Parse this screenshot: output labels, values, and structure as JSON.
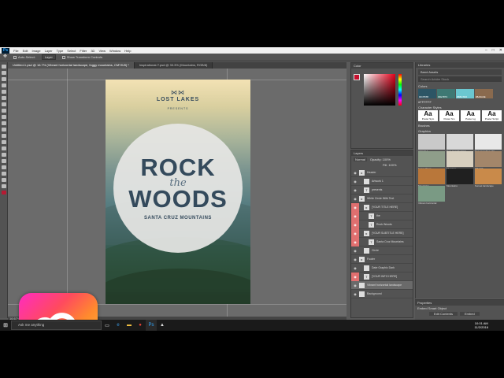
{
  "menu": {
    "app_icon": "Ps",
    "items": [
      "File",
      "Edit",
      "Image",
      "Layer",
      "Type",
      "Select",
      "Filter",
      "3D",
      "View",
      "Window",
      "Help"
    ]
  },
  "options": {
    "auto_select": "Auto-Select:",
    "layer_select": "Layer",
    "show_transform": "Show Transform Controls"
  },
  "tabs": [
    {
      "label": "Untitled-1.psd @ 16.7% (Vibrant horizontal landscape, foggy mountains, CMYK/8) *"
    },
    {
      "label": "Inspirational-T.psd @ 33.3% (Mountains, RGB/8)"
    }
  ],
  "poster": {
    "logo_mark": "⋈⋈",
    "brand": "LOST LAKES",
    "presents": "PRESENTS",
    "line1": "ROCK",
    "line2": "the",
    "line3": "WOODS",
    "subtitle": "SANTA CRUZ MOUNTAINS"
  },
  "status": {
    "zoom": "16.67%"
  },
  "color_panel": {
    "title": "Color",
    "fg_color": "#c8102e"
  },
  "layers_panel": {
    "title": "Layers",
    "mode": "Normal",
    "opacity": "Opacity: 100%",
    "fill": "Fill: 100%",
    "rows": [
      {
        "name": "Header",
        "icon": "folder-icon",
        "red": false,
        "sel": false,
        "indent": 0
      },
      {
        "name": "Artwork 1",
        "icon": "image-icon",
        "red": false,
        "sel": false,
        "indent": 1
      },
      {
        "name": "presents",
        "icon": "text-icon",
        "red": false,
        "sel": false,
        "indent": 1
      },
      {
        "name": "White Circle With Text",
        "icon": "folder-icon",
        "red": false,
        "sel": false,
        "indent": 0
      },
      {
        "name": "[YOUR TITLE HERE]",
        "icon": "folder-icon",
        "red": true,
        "sel": false,
        "indent": 1
      },
      {
        "name": "the",
        "icon": "text-icon",
        "red": true,
        "sel": false,
        "indent": 2
      },
      {
        "name": "Rock Woods",
        "icon": "text-icon",
        "red": true,
        "sel": false,
        "indent": 2
      },
      {
        "name": "[YOUR SUBTITLE HERE]",
        "icon": "folder-icon",
        "red": true,
        "sel": false,
        "indent": 1
      },
      {
        "name": "Santa Cruz Mountains",
        "icon": "text-icon",
        "red": true,
        "sel": false,
        "indent": 2
      },
      {
        "name": "Circle",
        "icon": "shape-icon",
        "red": false,
        "sel": false,
        "indent": 1
      },
      {
        "name": "Footer",
        "icon": "folder-icon",
        "red": false,
        "sel": false,
        "indent": 0
      },
      {
        "name": "Date Graphic Dark",
        "icon": "image-icon",
        "red": false,
        "sel": false,
        "indent": 1
      },
      {
        "name": "[YOUR INFO HERE]",
        "icon": "text-icon",
        "red": true,
        "sel": false,
        "indent": 1
      },
      {
        "name": "Vibrant horizontal landscape",
        "icon": "image-icon",
        "red": false,
        "sel": true,
        "indent": 0
      },
      {
        "name": "Background",
        "icon": "image-icon",
        "red": false,
        "sel": false,
        "indent": 0
      }
    ]
  },
  "libraries": {
    "title": "Libraries",
    "library_name": "Band Assets",
    "search_placeholder": "Search Adobe Stock",
    "colors_label": "Colors",
    "swatches": [
      {
        "hex": "#2C5565",
        "color": "#2c5565"
      },
      {
        "hex": "#3E7873",
        "color": "#3e7873"
      },
      {
        "hex": "#6BC7D0",
        "color": "#6bc7d0"
      },
      {
        "hex": "#8A6A4E",
        "color": "#8a6a4e"
      }
    ],
    "extra_swatch": "#FFFFFF",
    "char_label": "Character Styles",
    "char_styles": [
      {
        "glyph": "Aa",
        "name": "Poster Sym"
      },
      {
        "glyph": "Aa",
        "name": "Poster Sm"
      },
      {
        "glyph": "Aa",
        "name": "Poster Lg"
      },
      {
        "glyph": "Aa",
        "name": "Poster Script"
      }
    ],
    "brushes_label": "Brushes",
    "graphics_label": "Graphics",
    "graphics": [
      {
        "name": "Artwork 1",
        "color": "#c9c9c9"
      },
      {
        "name": "Date Graphic Dark",
        "color": "#d8d8d8"
      },
      {
        "name": "Date Graphic Light",
        "color": "#e8e8e8"
      },
      {
        "name": "Foggy Trees",
        "color": "#8f9e8a"
      },
      {
        "name": "Migration",
        "color": "#d7cfbf"
      },
      {
        "name": "Wild Elk",
        "color": "#a3866a"
      },
      {
        "name": "Mountains",
        "color": "#b9773a"
      },
      {
        "name": "Mountains",
        "color": "#202020"
      },
      {
        "name": "Sunset landscape",
        "color": "#c98a4a"
      },
      {
        "name": "Vibrant horizontal",
        "color": "#7a9a84"
      }
    ]
  },
  "properties": {
    "title": "Properties",
    "item": "Embed Smart Object",
    "edit": "Edit Contents",
    "embed": "Embed"
  },
  "taskbar": {
    "search": "Ask me anything",
    "time": "10:01 AM",
    "date": "11/2/2016"
  }
}
